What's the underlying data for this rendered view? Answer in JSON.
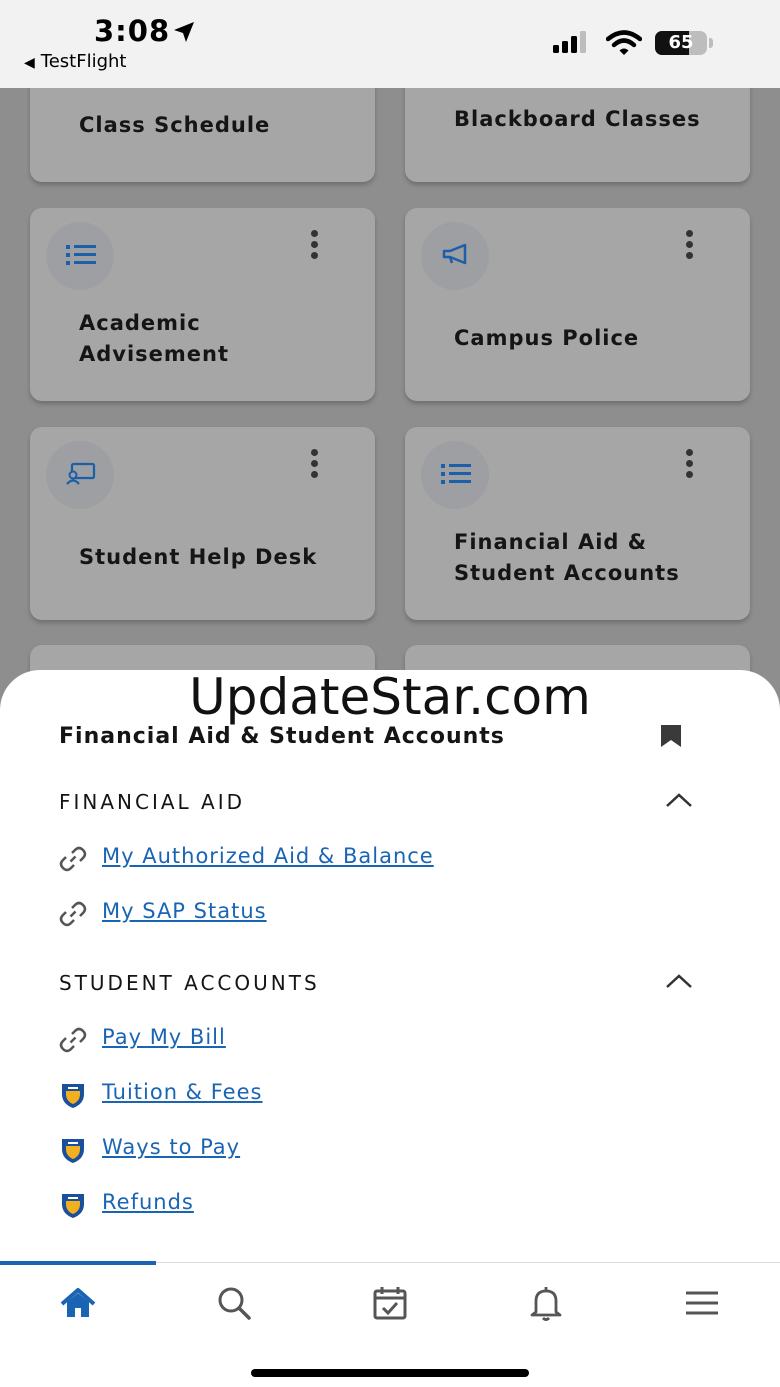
{
  "status_bar": {
    "time": "3:08",
    "back_app": "TestFlight",
    "battery": "65"
  },
  "tiles": [
    {
      "label": "Class Schedule",
      "icon": "none"
    },
    {
      "label": "Blackboard Classes",
      "icon": "none"
    },
    {
      "label": "Academic Advisement",
      "icon": "list-icon"
    },
    {
      "label": "Campus Police",
      "icon": "megaphone-icon"
    },
    {
      "label": "Student Help Desk",
      "icon": "help-desk-icon"
    },
    {
      "label": "Financial Aid & Student Accounts",
      "icon": "list-icon"
    }
  ],
  "watermark": "UpdateStar.com",
  "sheet": {
    "title": "Financial Aid & Student Accounts",
    "sections": [
      {
        "heading": "FINANCIAL AID",
        "links": [
          {
            "label": "My Authorized Aid & Balance",
            "icon": "link-icon"
          },
          {
            "label": "My SAP Status",
            "icon": "link-icon"
          }
        ]
      },
      {
        "heading": "STUDENT ACCOUNTS",
        "links": [
          {
            "label": "Pay My Bill",
            "icon": "link-icon"
          },
          {
            "label": "Tuition & Fees",
            "icon": "shield-logo-icon"
          },
          {
            "label": "Ways to Pay",
            "icon": "shield-logo-icon"
          },
          {
            "label": "Refunds",
            "icon": "shield-logo-icon"
          }
        ]
      }
    ]
  },
  "tab_bar": {
    "active": "home",
    "items": [
      "home-icon",
      "search-icon",
      "calendar-check-icon",
      "bell-icon",
      "menu-icon"
    ],
    "accent": "#1a64b4"
  },
  "colors": {
    "link": "#1a64b4",
    "overlay": "#8e8e8e"
  }
}
